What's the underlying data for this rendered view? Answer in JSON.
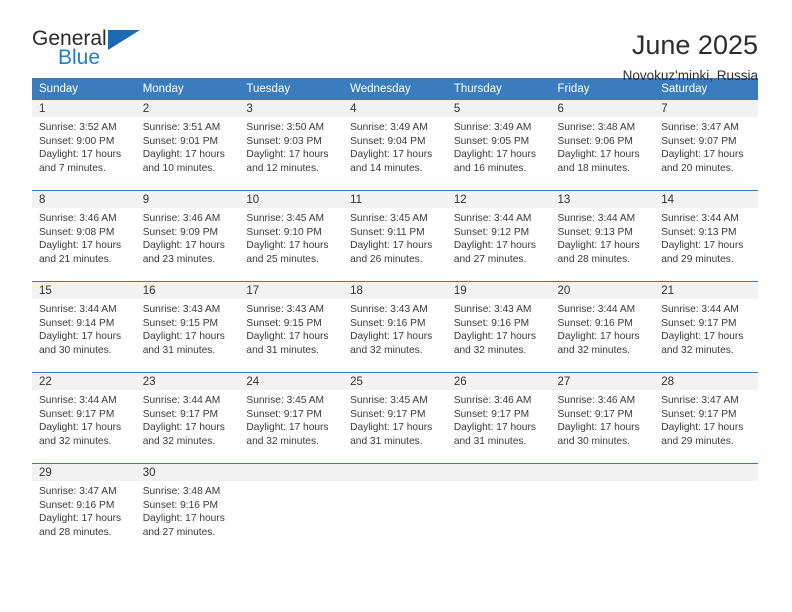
{
  "brand": {
    "word_one": "General",
    "word_two": "Blue",
    "triangle_color": "#1a6bb0",
    "blue_text_color": "#1f7fc4"
  },
  "header": {
    "title": "June 2025",
    "subtitle": "Novokuz'minki, Russia"
  },
  "theme": {
    "header_blue": "#3A7CBE",
    "day_band_gray": "#F2F2F2",
    "text_color": "#333333"
  },
  "weekday_headers": [
    "Sunday",
    "Monday",
    "Tuesday",
    "Wednesday",
    "Thursday",
    "Friday",
    "Saturday"
  ],
  "weeks": [
    [
      {
        "day": "1",
        "sunrise": "Sunrise: 3:52 AM",
        "sunset": "Sunset: 9:00 PM",
        "daylight_1": "Daylight: 17 hours",
        "daylight_2": "and 7 minutes."
      },
      {
        "day": "2",
        "sunrise": "Sunrise: 3:51 AM",
        "sunset": "Sunset: 9:01 PM",
        "daylight_1": "Daylight: 17 hours",
        "daylight_2": "and 10 minutes."
      },
      {
        "day": "3",
        "sunrise": "Sunrise: 3:50 AM",
        "sunset": "Sunset: 9:03 PM",
        "daylight_1": "Daylight: 17 hours",
        "daylight_2": "and 12 minutes."
      },
      {
        "day": "4",
        "sunrise": "Sunrise: 3:49 AM",
        "sunset": "Sunset: 9:04 PM",
        "daylight_1": "Daylight: 17 hours",
        "daylight_2": "and 14 minutes."
      },
      {
        "day": "5",
        "sunrise": "Sunrise: 3:49 AM",
        "sunset": "Sunset: 9:05 PM",
        "daylight_1": "Daylight: 17 hours",
        "daylight_2": "and 16 minutes."
      },
      {
        "day": "6",
        "sunrise": "Sunrise: 3:48 AM",
        "sunset": "Sunset: 9:06 PM",
        "daylight_1": "Daylight: 17 hours",
        "daylight_2": "and 18 minutes."
      },
      {
        "day": "7",
        "sunrise": "Sunrise: 3:47 AM",
        "sunset": "Sunset: 9:07 PM",
        "daylight_1": "Daylight: 17 hours",
        "daylight_2": "and 20 minutes."
      }
    ],
    [
      {
        "day": "8",
        "sunrise": "Sunrise: 3:46 AM",
        "sunset": "Sunset: 9:08 PM",
        "daylight_1": "Daylight: 17 hours",
        "daylight_2": "and 21 minutes."
      },
      {
        "day": "9",
        "sunrise": "Sunrise: 3:46 AM",
        "sunset": "Sunset: 9:09 PM",
        "daylight_1": "Daylight: 17 hours",
        "daylight_2": "and 23 minutes."
      },
      {
        "day": "10",
        "sunrise": "Sunrise: 3:45 AM",
        "sunset": "Sunset: 9:10 PM",
        "daylight_1": "Daylight: 17 hours",
        "daylight_2": "and 25 minutes."
      },
      {
        "day": "11",
        "sunrise": "Sunrise: 3:45 AM",
        "sunset": "Sunset: 9:11 PM",
        "daylight_1": "Daylight: 17 hours",
        "daylight_2": "and 26 minutes."
      },
      {
        "day": "12",
        "sunrise": "Sunrise: 3:44 AM",
        "sunset": "Sunset: 9:12 PM",
        "daylight_1": "Daylight: 17 hours",
        "daylight_2": "and 27 minutes."
      },
      {
        "day": "13",
        "sunrise": "Sunrise: 3:44 AM",
        "sunset": "Sunset: 9:13 PM",
        "daylight_1": "Daylight: 17 hours",
        "daylight_2": "and 28 minutes."
      },
      {
        "day": "14",
        "sunrise": "Sunrise: 3:44 AM",
        "sunset": "Sunset: 9:13 PM",
        "daylight_1": "Daylight: 17 hours",
        "daylight_2": "and 29 minutes."
      }
    ],
    [
      {
        "day": "15",
        "sunrise": "Sunrise: 3:44 AM",
        "sunset": "Sunset: 9:14 PM",
        "daylight_1": "Daylight: 17 hours",
        "daylight_2": "and 30 minutes."
      },
      {
        "day": "16",
        "sunrise": "Sunrise: 3:43 AM",
        "sunset": "Sunset: 9:15 PM",
        "daylight_1": "Daylight: 17 hours",
        "daylight_2": "and 31 minutes."
      },
      {
        "day": "17",
        "sunrise": "Sunrise: 3:43 AM",
        "sunset": "Sunset: 9:15 PM",
        "daylight_1": "Daylight: 17 hours",
        "daylight_2": "and 31 minutes."
      },
      {
        "day": "18",
        "sunrise": "Sunrise: 3:43 AM",
        "sunset": "Sunset: 9:16 PM",
        "daylight_1": "Daylight: 17 hours",
        "daylight_2": "and 32 minutes."
      },
      {
        "day": "19",
        "sunrise": "Sunrise: 3:43 AM",
        "sunset": "Sunset: 9:16 PM",
        "daylight_1": "Daylight: 17 hours",
        "daylight_2": "and 32 minutes."
      },
      {
        "day": "20",
        "sunrise": "Sunrise: 3:44 AM",
        "sunset": "Sunset: 9:16 PM",
        "daylight_1": "Daylight: 17 hours",
        "daylight_2": "and 32 minutes."
      },
      {
        "day": "21",
        "sunrise": "Sunrise: 3:44 AM",
        "sunset": "Sunset: 9:17 PM",
        "daylight_1": "Daylight: 17 hours",
        "daylight_2": "and 32 minutes."
      }
    ],
    [
      {
        "day": "22",
        "sunrise": "Sunrise: 3:44 AM",
        "sunset": "Sunset: 9:17 PM",
        "daylight_1": "Daylight: 17 hours",
        "daylight_2": "and 32 minutes."
      },
      {
        "day": "23",
        "sunrise": "Sunrise: 3:44 AM",
        "sunset": "Sunset: 9:17 PM",
        "daylight_1": "Daylight: 17 hours",
        "daylight_2": "and 32 minutes."
      },
      {
        "day": "24",
        "sunrise": "Sunrise: 3:45 AM",
        "sunset": "Sunset: 9:17 PM",
        "daylight_1": "Daylight: 17 hours",
        "daylight_2": "and 32 minutes."
      },
      {
        "day": "25",
        "sunrise": "Sunrise: 3:45 AM",
        "sunset": "Sunset: 9:17 PM",
        "daylight_1": "Daylight: 17 hours",
        "daylight_2": "and 31 minutes."
      },
      {
        "day": "26",
        "sunrise": "Sunrise: 3:46 AM",
        "sunset": "Sunset: 9:17 PM",
        "daylight_1": "Daylight: 17 hours",
        "daylight_2": "and 31 minutes."
      },
      {
        "day": "27",
        "sunrise": "Sunrise: 3:46 AM",
        "sunset": "Sunset: 9:17 PM",
        "daylight_1": "Daylight: 17 hours",
        "daylight_2": "and 30 minutes."
      },
      {
        "day": "28",
        "sunrise": "Sunrise: 3:47 AM",
        "sunset": "Sunset: 9:17 PM",
        "daylight_1": "Daylight: 17 hours",
        "daylight_2": "and 29 minutes."
      }
    ],
    [
      {
        "day": "29",
        "sunrise": "Sunrise: 3:47 AM",
        "sunset": "Sunset: 9:16 PM",
        "daylight_1": "Daylight: 17 hours",
        "daylight_2": "and 28 minutes."
      },
      {
        "day": "30",
        "sunrise": "Sunrise: 3:48 AM",
        "sunset": "Sunset: 9:16 PM",
        "daylight_1": "Daylight: 17 hours",
        "daylight_2": "and 27 minutes."
      },
      {
        "day": "",
        "sunrise": "",
        "sunset": "",
        "daylight_1": "",
        "daylight_2": ""
      },
      {
        "day": "",
        "sunrise": "",
        "sunset": "",
        "daylight_1": "",
        "daylight_2": ""
      },
      {
        "day": "",
        "sunrise": "",
        "sunset": "",
        "daylight_1": "",
        "daylight_2": ""
      },
      {
        "day": "",
        "sunrise": "",
        "sunset": "",
        "daylight_1": "",
        "daylight_2": ""
      },
      {
        "day": "",
        "sunrise": "",
        "sunset": "",
        "daylight_1": "",
        "daylight_2": ""
      }
    ]
  ]
}
